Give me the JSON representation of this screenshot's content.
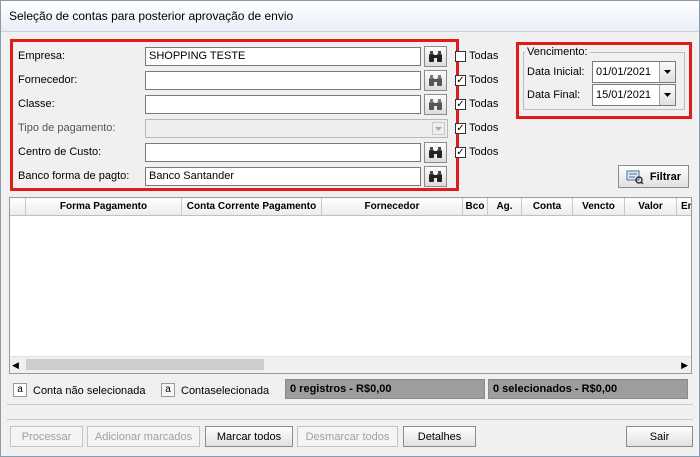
{
  "window": {
    "title": "Seleção de contas para posterior aprovação de envio"
  },
  "filters": {
    "empresa": {
      "label": "Empresa:",
      "value": "SHOPPING TESTE",
      "checkbox_label": "Todas",
      "checked": false
    },
    "fornecedor": {
      "label": "Fornecedor:",
      "value": "",
      "checkbox_label": "Todos",
      "checked": true
    },
    "classe": {
      "label": "Classe:",
      "value": "",
      "checkbox_label": "Todas",
      "checked": true
    },
    "tipo_pagamento": {
      "label": "Tipo de pagamento:",
      "value": "",
      "checkbox_label": "Todos",
      "checked": true
    },
    "centro_custo": {
      "label": "Centro de Custo:",
      "value": "",
      "checkbox_label": "Todos",
      "checked": true
    },
    "banco_forma": {
      "label": "Banco forma de pagto:",
      "value": "Banco Santander"
    }
  },
  "vencimento": {
    "group_title": "Vencimento:",
    "data_inicial_label": "Data Inicial:",
    "data_inicial": "01/01/2021",
    "data_final_label": "Data Final:",
    "data_final": "15/01/2021"
  },
  "filtrar_label": "Filtrar",
  "grid": {
    "columns": [
      "Forma Pagamento",
      "Conta Corrente Pagamento",
      "Fornecedor",
      "Bco",
      "Ag.",
      "Conta",
      "Vencto",
      "Valor",
      "Empr"
    ]
  },
  "legend": {
    "nao_selecionada_icon": "a",
    "nao_selecionada": "Conta não selecionada",
    "selecionada_icon": "a",
    "selecionada": "Contaselecionada"
  },
  "status": {
    "registros": "0 registros - R$0,00",
    "selecionados": "0 selecionados - R$0,00"
  },
  "buttons": {
    "processar": "Processar",
    "adicionar_marcados": "Adicionar marcados",
    "marcar_todos": "Marcar todos",
    "desmarcar_todos": "Desmarcar todos",
    "detalhes": "Detalhes",
    "sair": "Sair"
  },
  "icons": {
    "lookup": "binoculars-icon",
    "dropdown": "chevron-down-icon",
    "filter": "filter-icon"
  },
  "colors": {
    "highlight": "#e01b1b",
    "status_bg": "#9d9d9d"
  }
}
